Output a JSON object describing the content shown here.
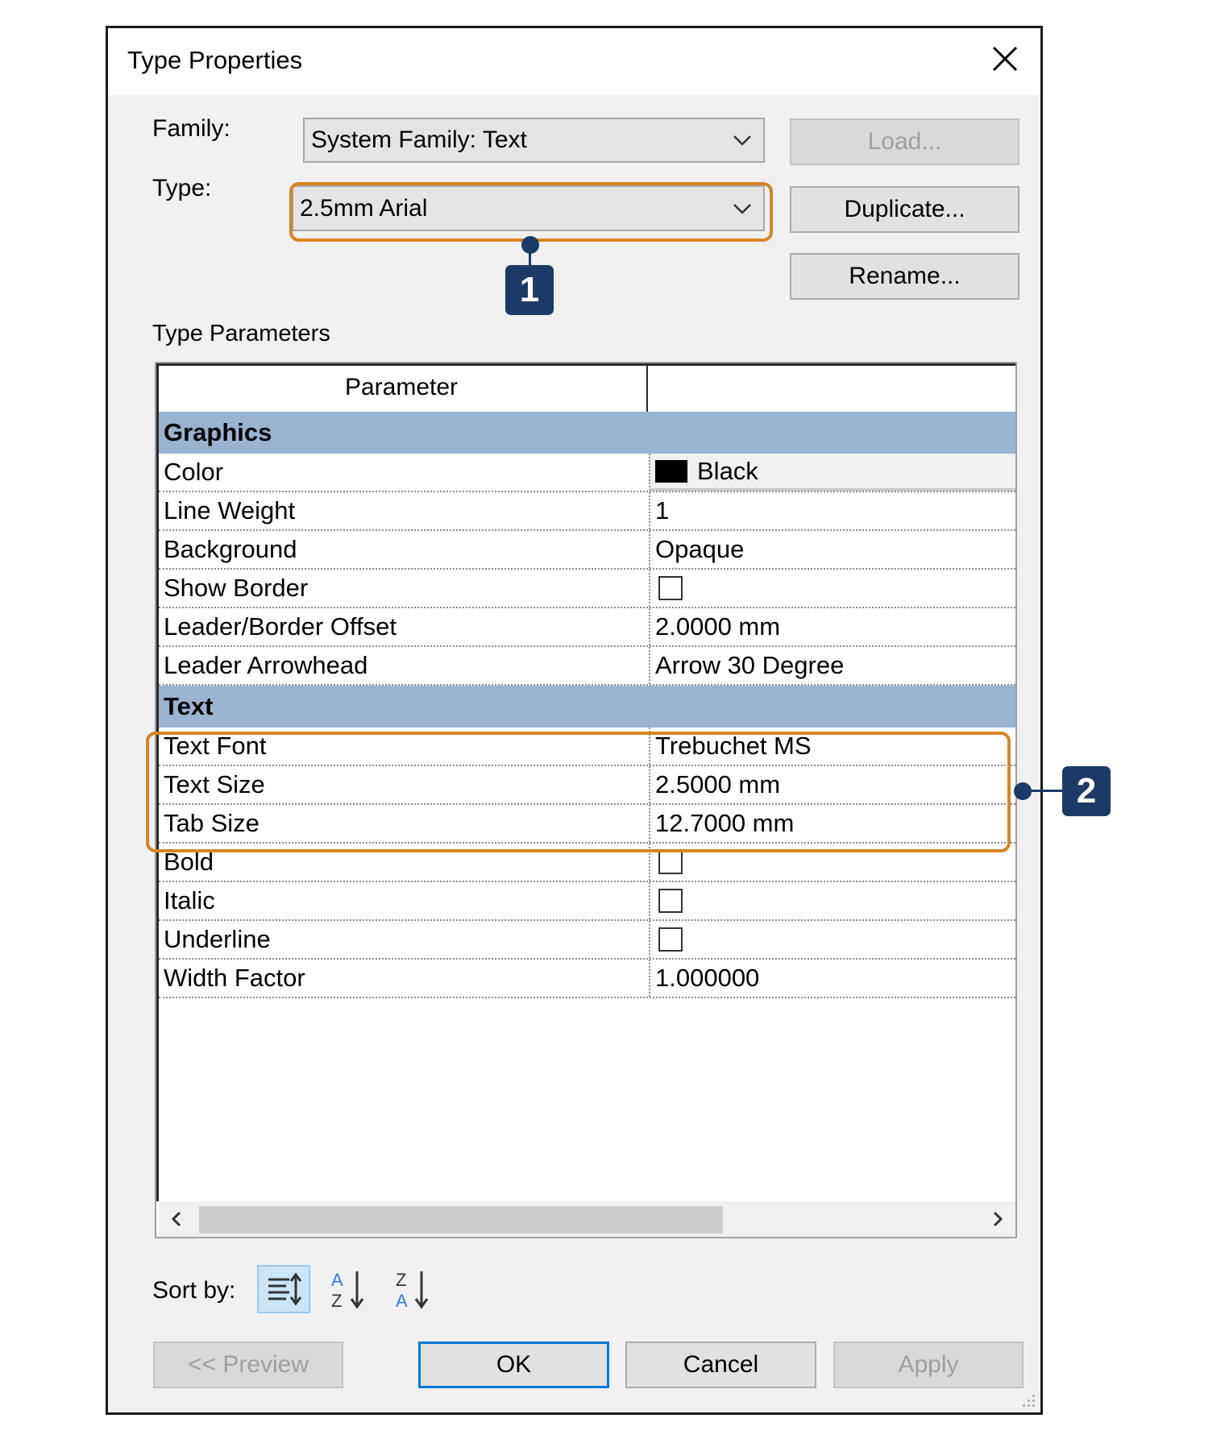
{
  "dialog": {
    "title": "Type Properties",
    "family_label": "Family:",
    "family_value": "System Family: Text",
    "type_label": "Type:",
    "type_value": "2.5mm Arial",
    "load_button": "Load...",
    "duplicate_button": "Duplicate...",
    "rename_button": "Rename...",
    "type_parameters_label": "Type Parameters",
    "grid": {
      "header_parameter": "Parameter",
      "header_value": "",
      "groups": [
        {
          "name": "Graphics",
          "rows": [
            {
              "name": "Color",
              "value": "Black",
              "kind": "color"
            },
            {
              "name": "Line Weight",
              "value": "1",
              "kind": "text"
            },
            {
              "name": "Background",
              "value": "Opaque",
              "kind": "text"
            },
            {
              "name": "Show Border",
              "value": "",
              "kind": "checkbox",
              "checked": false
            },
            {
              "name": "Leader/Border Offset",
              "value": "2.0000 mm",
              "kind": "text"
            },
            {
              "name": "Leader Arrowhead",
              "value": "Arrow 30 Degree",
              "kind": "text"
            }
          ]
        },
        {
          "name": "Text",
          "rows": [
            {
              "name": "Text Font",
              "value": "Trebuchet MS",
              "kind": "text"
            },
            {
              "name": "Text Size",
              "value": "2.5000 mm",
              "kind": "text"
            },
            {
              "name": "Tab Size",
              "value": "12.7000 mm",
              "kind": "text"
            },
            {
              "name": "Bold",
              "value": "",
              "kind": "checkbox",
              "checked": false
            },
            {
              "name": "Italic",
              "value": "",
              "kind": "checkbox",
              "checked": false
            },
            {
              "name": "Underline",
              "value": "",
              "kind": "checkbox",
              "checked": false
            },
            {
              "name": "Width Factor",
              "value": "1.000000",
              "kind": "text"
            }
          ]
        }
      ]
    },
    "sort_by_label": "Sort by:",
    "sort_options": [
      "grouped-sort-icon",
      "sort-a-z-icon",
      "sort-z-a-icon"
    ],
    "sort_a_z": {
      "top": "A",
      "bottom": "Z"
    },
    "sort_z_a": {
      "top": "Z",
      "bottom": "A"
    },
    "preview_button": "<< Preview",
    "ok_button": "OK",
    "cancel_button": "Cancel",
    "apply_button": "Apply"
  },
  "callouts": [
    {
      "number": "1"
    },
    {
      "number": "2"
    }
  ],
  "colors": {
    "highlight": "#d68524",
    "callout": "#1b3a66",
    "group_header": "#99b4d1",
    "focus_border": "#0078d7"
  }
}
